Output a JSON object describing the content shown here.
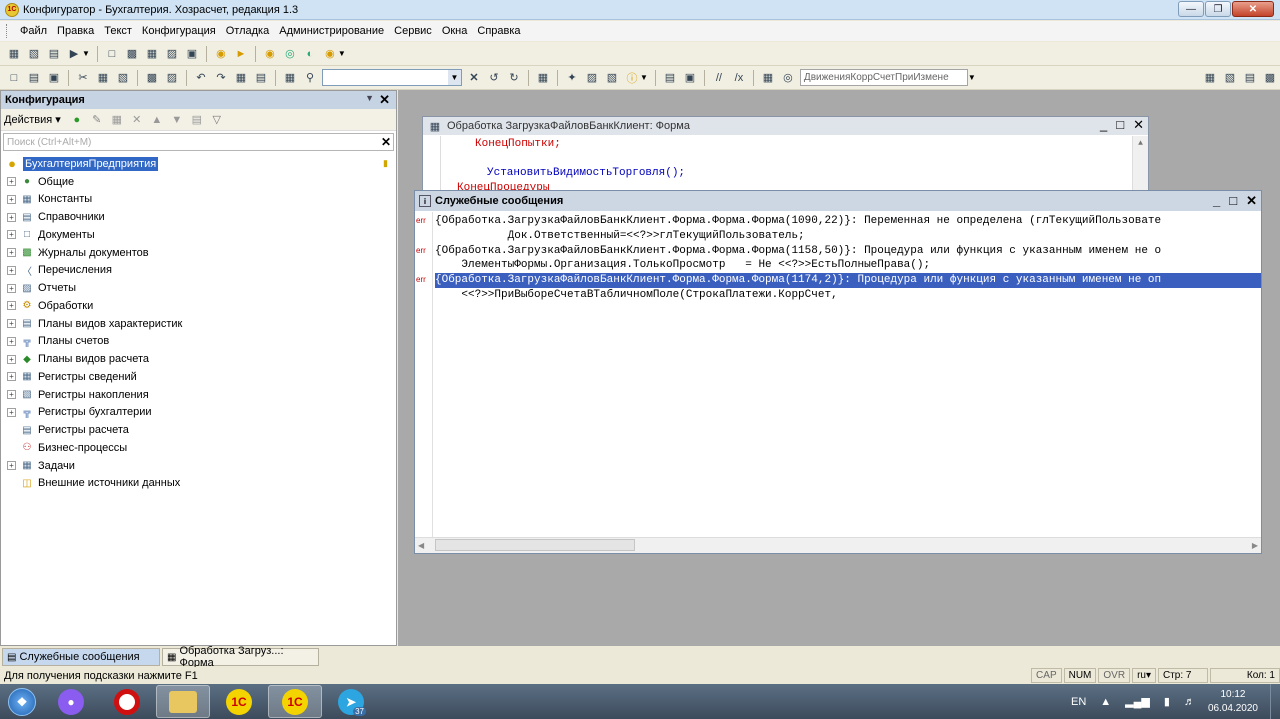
{
  "window": {
    "title": "Конфигуратор - Бухгалтерия. Хозрасчет, редакция 1.3"
  },
  "menu": [
    "Файл",
    "Правка",
    "Текст",
    "Конфигурация",
    "Отладка",
    "Администрирование",
    "Сервис",
    "Окна",
    "Справка"
  ],
  "toolbar": {
    "procedure_combo": "ДвиженияКоррСчетПриИзмене"
  },
  "config_panel": {
    "title": "Конфигурация",
    "actions_label": "Действия",
    "search_placeholder": "Поиск (Ctrl+Alt+M)",
    "root": "БухгалтерияПредприятия",
    "items": [
      {
        "label": "Общие",
        "icon": "common-icon",
        "expandable": true
      },
      {
        "label": "Константы",
        "icon": "constants-icon",
        "expandable": true
      },
      {
        "label": "Справочники",
        "icon": "catalogs-icon",
        "expandable": true
      },
      {
        "label": "Документы",
        "icon": "documents-icon",
        "expandable": true
      },
      {
        "label": "Журналы документов",
        "icon": "journals-icon",
        "expandable": true
      },
      {
        "label": "Перечисления",
        "icon": "enums-icon",
        "expandable": true
      },
      {
        "label": "Отчеты",
        "icon": "reports-icon",
        "expandable": true
      },
      {
        "label": "Обработки",
        "icon": "processing-icon",
        "expandable": true
      },
      {
        "label": "Планы видов характеристик",
        "icon": "chart-characteristics-icon",
        "expandable": true
      },
      {
        "label": "Планы счетов",
        "icon": "chart-accounts-icon",
        "expandable": true
      },
      {
        "label": "Планы видов расчета",
        "icon": "chart-calc-icon",
        "expandable": true
      },
      {
        "label": "Регистры сведений",
        "icon": "info-registers-icon",
        "expandable": true
      },
      {
        "label": "Регистры накопления",
        "icon": "accum-registers-icon",
        "expandable": true
      },
      {
        "label": "Регистры бухгалтерии",
        "icon": "acc-registers-icon",
        "expandable": true
      },
      {
        "label": "Регистры расчета",
        "icon": "calc-registers-icon",
        "expandable": false
      },
      {
        "label": "Бизнес-процессы",
        "icon": "business-process-icon",
        "expandable": false
      },
      {
        "label": "Задачи",
        "icon": "tasks-icon",
        "expandable": true
      },
      {
        "label": "Внешние источники данных",
        "icon": "external-data-icon",
        "expandable": false
      }
    ]
  },
  "form_window": {
    "title": "Обработка ЗагрузкаФайловБанкКлиент: Форма",
    "code_lines": [
      "КонецПопытки;",
      "УстановитьВидимостьТорговля();",
      "КонецПроцедуры"
    ]
  },
  "messages_window": {
    "title": "Служебные сообщения",
    "rows": [
      {
        "tag": "err",
        "text": "{Обработка.ЗагрузкаФайловБанкКлиент.Форма.Форма.Форма(1090,22)}: Переменная не определена (глТекущийПользовате"
      },
      {
        "tag": "",
        "text": "           Док.Ответственный=<<?>>глТекущийПользователь;"
      },
      {
        "tag": "err",
        "text": "{Обработка.ЗагрузкаФайловБанкКлиент.Форма.Форма.Форма(1158,50)}: Процедура или функция с указанным именем не о"
      },
      {
        "tag": "",
        "text": "    ЭлементыФормы.Организация.ТолькоПросмотр   = Не <<?>>ЕстьПолныеПрава();"
      },
      {
        "tag": "err",
        "text": "{Обработка.ЗагрузкаФайловБанкКлиент.Форма.Форма.Форма(1174,2)}: Процедура или функция с указанным именем не оп"
      },
      {
        "tag": "",
        "text": "    <<?>>ПриВыбореСчетаВТабличномПоле(СтрокаПлатежи.КоррСчет,"
      }
    ]
  },
  "window_tabs": [
    "Служебные сообщения",
    "Обработка Загруз...: Форма"
  ],
  "status": {
    "hint": "Для получения подсказки нажмите F1",
    "cap": "CAP",
    "num": "NUM",
    "ovr": "OVR",
    "lang": "ru",
    "line": "Стр: 7",
    "col": "Кол: 1"
  },
  "taskbar": {
    "lang": "EN",
    "time": "10:12",
    "date": "06.04.2020",
    "badge": "37"
  }
}
